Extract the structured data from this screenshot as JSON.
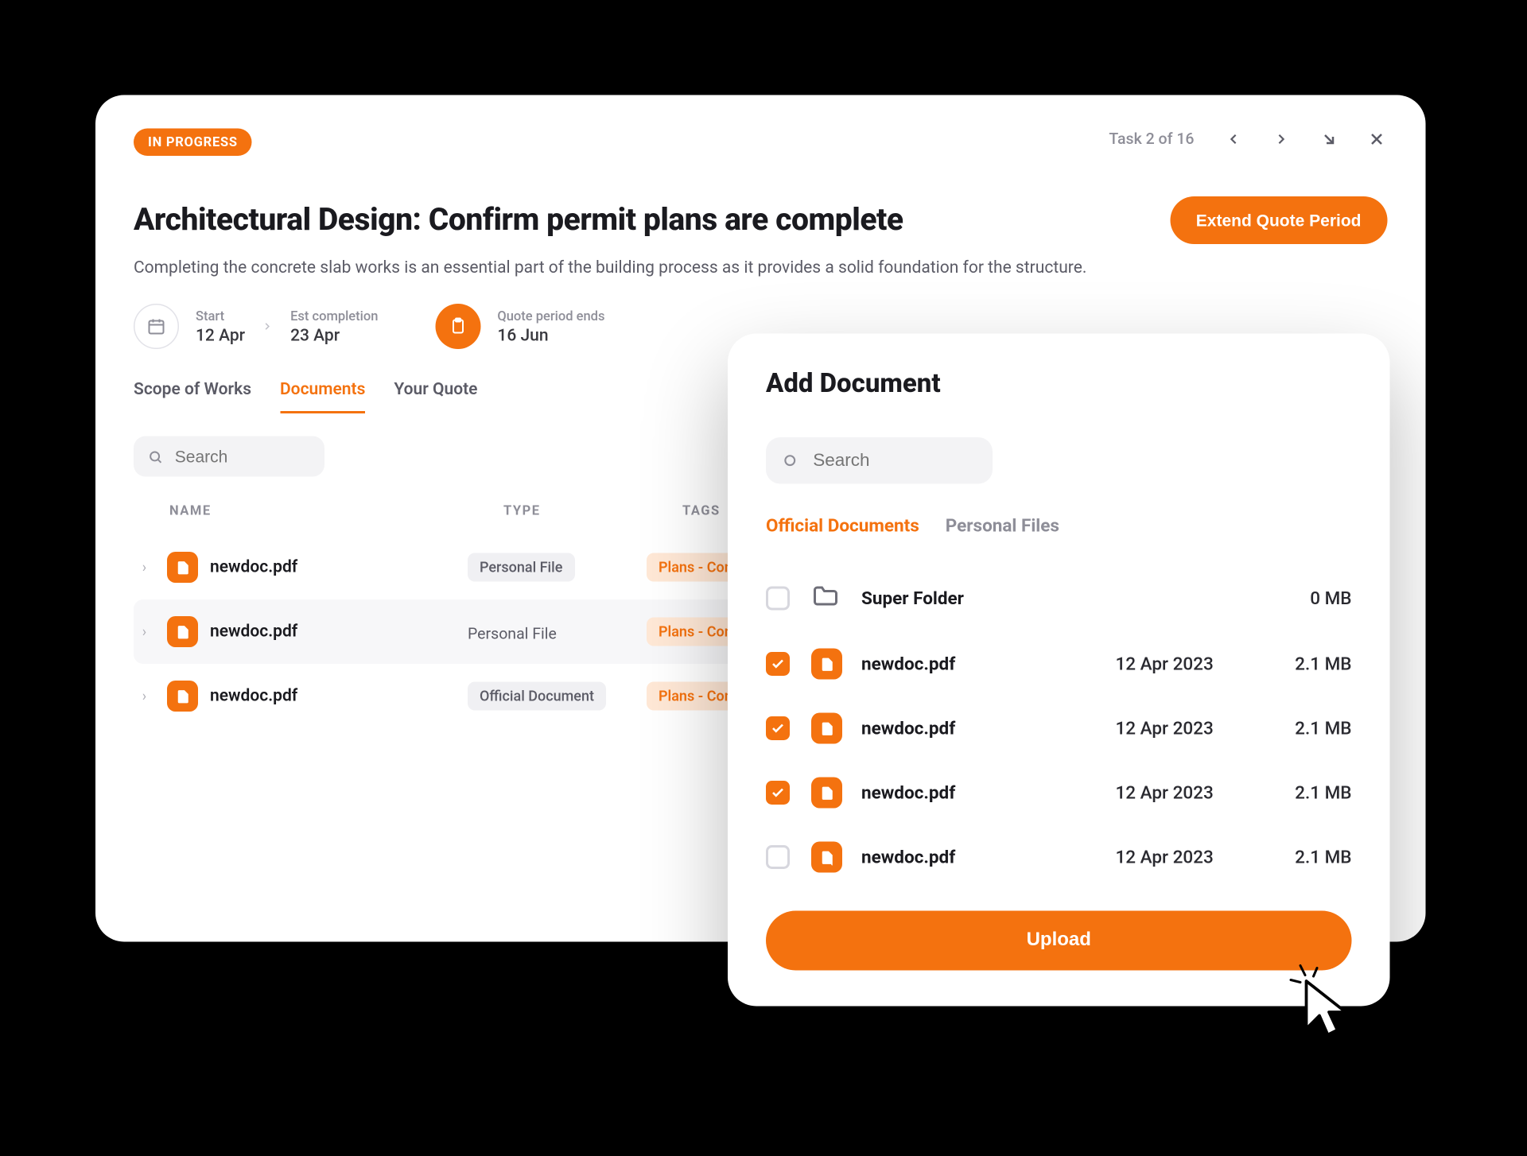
{
  "header": {
    "status_badge": "IN PROGRESS",
    "task_count": "Task 2 of 16",
    "title": "Architectural Design: Confirm permit plans are complete",
    "subtitle": "Completing the concrete slab works is an essential part of the building process as it provides a solid foundation for the structure.",
    "extend_button": "Extend Quote Period"
  },
  "dates": {
    "start_label": "Start",
    "start_value": "12 Apr",
    "est_label": "Est completion",
    "est_value": "23 Apr",
    "quote_label": "Quote period ends",
    "quote_value": "16 Jun"
  },
  "tabs": {
    "scope": "Scope of Works",
    "documents": "Documents",
    "quote": "Your Quote"
  },
  "search": {
    "placeholder": "Search"
  },
  "table": {
    "col_name": "NAME",
    "col_type": "TYPE",
    "col_tags": "TAGS",
    "rows": [
      {
        "name": "newdoc.pdf",
        "type": "Personal File",
        "tag": "Plans - Constru"
      },
      {
        "name": "newdoc.pdf",
        "type": "Personal File",
        "tag": "Plans - Constr"
      },
      {
        "name": "newdoc.pdf",
        "type": "Official Document",
        "tag": "Plans - Constr"
      }
    ]
  },
  "modal": {
    "title": "Add Document",
    "search_placeholder": "Search",
    "tab_official": "Official Documents",
    "tab_personal": "Personal Files",
    "folder": {
      "name": "Super Folder",
      "size": "0 MB"
    },
    "files": [
      {
        "checked": true,
        "name": "newdoc.pdf",
        "date": "12 Apr 2023",
        "size": "2.1 MB"
      },
      {
        "checked": true,
        "name": "newdoc.pdf",
        "date": "12 Apr 2023",
        "size": "2.1 MB"
      },
      {
        "checked": true,
        "name": "newdoc.pdf",
        "date": "12 Apr 2023",
        "size": "2.1 MB"
      },
      {
        "checked": false,
        "name": "newdoc.pdf",
        "date": "12 Apr 2023",
        "size": "2.1 MB"
      }
    ],
    "upload": "Upload"
  }
}
